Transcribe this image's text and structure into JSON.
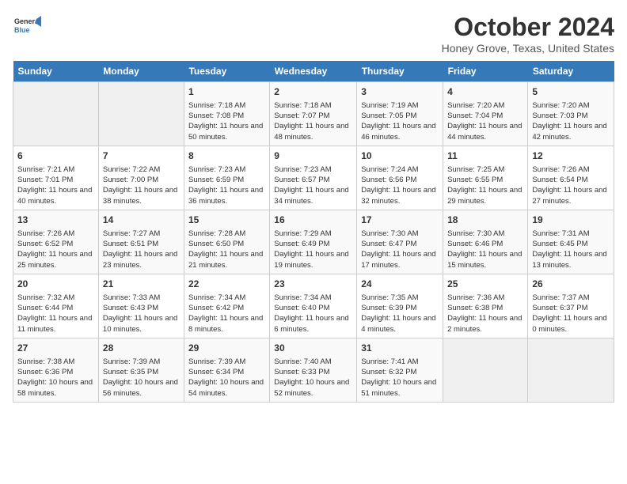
{
  "header": {
    "logo_line1": "General",
    "logo_line2": "Blue",
    "month": "October 2024",
    "location": "Honey Grove, Texas, United States"
  },
  "days_of_week": [
    "Sunday",
    "Monday",
    "Tuesday",
    "Wednesday",
    "Thursday",
    "Friday",
    "Saturday"
  ],
  "weeks": [
    [
      {
        "day": "",
        "content": ""
      },
      {
        "day": "",
        "content": ""
      },
      {
        "day": "1",
        "content": "Sunrise: 7:18 AM\nSunset: 7:08 PM\nDaylight: 11 hours and 50 minutes."
      },
      {
        "day": "2",
        "content": "Sunrise: 7:18 AM\nSunset: 7:07 PM\nDaylight: 11 hours and 48 minutes."
      },
      {
        "day": "3",
        "content": "Sunrise: 7:19 AM\nSunset: 7:05 PM\nDaylight: 11 hours and 46 minutes."
      },
      {
        "day": "4",
        "content": "Sunrise: 7:20 AM\nSunset: 7:04 PM\nDaylight: 11 hours and 44 minutes."
      },
      {
        "day": "5",
        "content": "Sunrise: 7:20 AM\nSunset: 7:03 PM\nDaylight: 11 hours and 42 minutes."
      }
    ],
    [
      {
        "day": "6",
        "content": "Sunrise: 7:21 AM\nSunset: 7:01 PM\nDaylight: 11 hours and 40 minutes."
      },
      {
        "day": "7",
        "content": "Sunrise: 7:22 AM\nSunset: 7:00 PM\nDaylight: 11 hours and 38 minutes."
      },
      {
        "day": "8",
        "content": "Sunrise: 7:23 AM\nSunset: 6:59 PM\nDaylight: 11 hours and 36 minutes."
      },
      {
        "day": "9",
        "content": "Sunrise: 7:23 AM\nSunset: 6:57 PM\nDaylight: 11 hours and 34 minutes."
      },
      {
        "day": "10",
        "content": "Sunrise: 7:24 AM\nSunset: 6:56 PM\nDaylight: 11 hours and 32 minutes."
      },
      {
        "day": "11",
        "content": "Sunrise: 7:25 AM\nSunset: 6:55 PM\nDaylight: 11 hours and 29 minutes."
      },
      {
        "day": "12",
        "content": "Sunrise: 7:26 AM\nSunset: 6:54 PM\nDaylight: 11 hours and 27 minutes."
      }
    ],
    [
      {
        "day": "13",
        "content": "Sunrise: 7:26 AM\nSunset: 6:52 PM\nDaylight: 11 hours and 25 minutes."
      },
      {
        "day": "14",
        "content": "Sunrise: 7:27 AM\nSunset: 6:51 PM\nDaylight: 11 hours and 23 minutes."
      },
      {
        "day": "15",
        "content": "Sunrise: 7:28 AM\nSunset: 6:50 PM\nDaylight: 11 hours and 21 minutes."
      },
      {
        "day": "16",
        "content": "Sunrise: 7:29 AM\nSunset: 6:49 PM\nDaylight: 11 hours and 19 minutes."
      },
      {
        "day": "17",
        "content": "Sunrise: 7:30 AM\nSunset: 6:47 PM\nDaylight: 11 hours and 17 minutes."
      },
      {
        "day": "18",
        "content": "Sunrise: 7:30 AM\nSunset: 6:46 PM\nDaylight: 11 hours and 15 minutes."
      },
      {
        "day": "19",
        "content": "Sunrise: 7:31 AM\nSunset: 6:45 PM\nDaylight: 11 hours and 13 minutes."
      }
    ],
    [
      {
        "day": "20",
        "content": "Sunrise: 7:32 AM\nSunset: 6:44 PM\nDaylight: 11 hours and 11 minutes."
      },
      {
        "day": "21",
        "content": "Sunrise: 7:33 AM\nSunset: 6:43 PM\nDaylight: 11 hours and 10 minutes."
      },
      {
        "day": "22",
        "content": "Sunrise: 7:34 AM\nSunset: 6:42 PM\nDaylight: 11 hours and 8 minutes."
      },
      {
        "day": "23",
        "content": "Sunrise: 7:34 AM\nSunset: 6:40 PM\nDaylight: 11 hours and 6 minutes."
      },
      {
        "day": "24",
        "content": "Sunrise: 7:35 AM\nSunset: 6:39 PM\nDaylight: 11 hours and 4 minutes."
      },
      {
        "day": "25",
        "content": "Sunrise: 7:36 AM\nSunset: 6:38 PM\nDaylight: 11 hours and 2 minutes."
      },
      {
        "day": "26",
        "content": "Sunrise: 7:37 AM\nSunset: 6:37 PM\nDaylight: 11 hours and 0 minutes."
      }
    ],
    [
      {
        "day": "27",
        "content": "Sunrise: 7:38 AM\nSunset: 6:36 PM\nDaylight: 10 hours and 58 minutes."
      },
      {
        "day": "28",
        "content": "Sunrise: 7:39 AM\nSunset: 6:35 PM\nDaylight: 10 hours and 56 minutes."
      },
      {
        "day": "29",
        "content": "Sunrise: 7:39 AM\nSunset: 6:34 PM\nDaylight: 10 hours and 54 minutes."
      },
      {
        "day": "30",
        "content": "Sunrise: 7:40 AM\nSunset: 6:33 PM\nDaylight: 10 hours and 52 minutes."
      },
      {
        "day": "31",
        "content": "Sunrise: 7:41 AM\nSunset: 6:32 PM\nDaylight: 10 hours and 51 minutes."
      },
      {
        "day": "",
        "content": ""
      },
      {
        "day": "",
        "content": ""
      }
    ]
  ]
}
